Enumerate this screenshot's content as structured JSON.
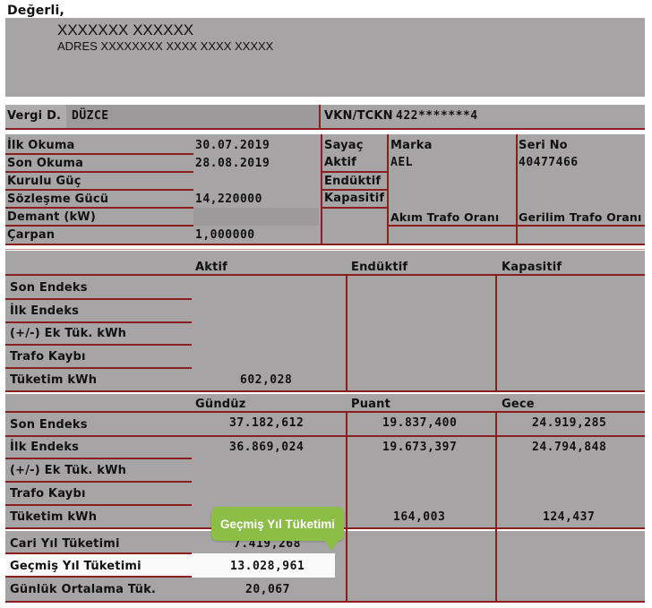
{
  "greeting": "Değerli,",
  "customer": {
    "name": "XXXXXXX XXXXXX",
    "address": "ADRES XXXXXXXX XXXX  XXXX XXXXX"
  },
  "tax": {
    "office_label": "Vergi D.",
    "office_value": "DÜZCE",
    "id_label": "VKN/TCKN",
    "id_value": "422*******4"
  },
  "reading": {
    "rows": [
      {
        "label": "İlk Okuma",
        "value": "30.07.2019"
      },
      {
        "label": "Son Okuma",
        "value": "28.08.2019"
      },
      {
        "label": "Kurulu Güç",
        "value": ""
      },
      {
        "label": "Sözleşme Gücü",
        "value": "14,220000"
      },
      {
        "label": "Demant (kW)",
        "value": ""
      },
      {
        "label": "Çarpan",
        "value": "1,000000"
      }
    ]
  },
  "meter": {
    "col_sayac": "Sayaç",
    "col_marka": "Marka",
    "col_seri": "Seri No",
    "types": [
      "Aktif",
      "Endüktif",
      "Kapasitif"
    ],
    "brand": "AEL",
    "serial": "40477466",
    "akim_trafo": "Akım Trafo Oranı",
    "gerilim_trafo": "Gerilim Trafo Oranı"
  },
  "energy_table": {
    "headers": [
      "Aktif",
      "Endüktif",
      "Kapasitif"
    ],
    "rows": [
      {
        "label": "Son Endeks",
        "values": [
          "",
          "",
          ""
        ]
      },
      {
        "label": "İlk Endeks",
        "values": [
          "",
          "",
          ""
        ]
      },
      {
        "label": "(+/-) Ek Tük. kWh",
        "values": [
          "",
          "",
          ""
        ]
      },
      {
        "label": "Trafo Kaybı",
        "values": [
          "",
          "",
          ""
        ]
      },
      {
        "label": "Tüketim kWh",
        "values": [
          "602,028",
          "",
          ""
        ]
      }
    ]
  },
  "tariff_table": {
    "headers": [
      "Gündüz",
      "Puant",
      "Gece"
    ],
    "rows": [
      {
        "label": "Son Endeks",
        "values": [
          "37.182,612",
          "19.837,400",
          "24.919,285"
        ]
      },
      {
        "label": "İlk Endeks",
        "values": [
          "36.869,024",
          "19.673,397",
          "24.794,848"
        ]
      },
      {
        "label": "(+/-) Ek Tük. kWh",
        "values": [
          "",
          "",
          ""
        ]
      },
      {
        "label": "Trafo Kaybı",
        "values": [
          "",
          "",
          ""
        ]
      },
      {
        "label": "Tüketim kWh",
        "values": [
          "",
          "164,003",
          "124,437"
        ]
      }
    ]
  },
  "summary": {
    "rows": [
      {
        "label": "Cari Yıl Tüketimi",
        "value": "7.419,268"
      },
      {
        "label": "Geçmiş Yıl Tüketimi",
        "value": "13.028,961"
      },
      {
        "label": "Günlük Ortalama Tük.",
        "value": "20,067"
      }
    ]
  },
  "tooltip": {
    "text": "Geçmiş Yıl Tüketimi",
    "color": "#8cbd45"
  },
  "colors": {
    "rule": "#8b1e1e",
    "panel": "#a6a4a4",
    "highlight": "#fafafa"
  }
}
